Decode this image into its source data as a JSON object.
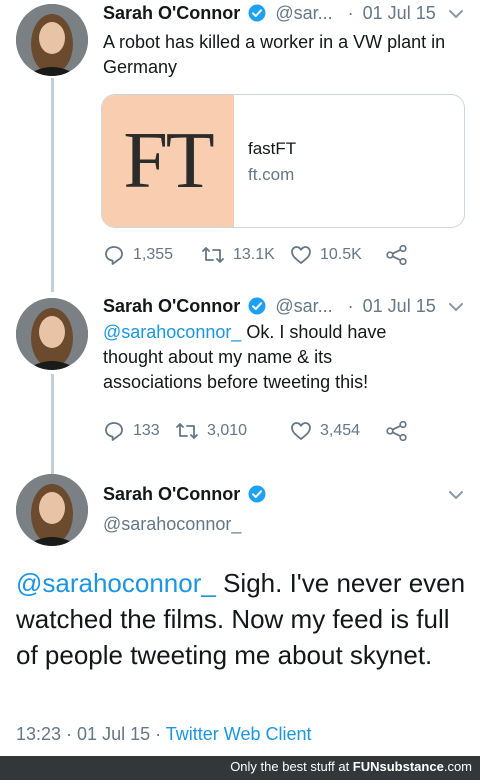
{
  "tweets": [
    {
      "name": "Sarah O'Connor",
      "handle": "@sar...",
      "dot": "·",
      "date": "01 Jul 15",
      "text": "A robot has killed a worker in a VW plant in Germany",
      "card": {
        "logo": "FT",
        "title": "fastFT",
        "domain": "ft.com"
      },
      "replies": "1,355",
      "retweets": "13.1K",
      "likes": "10.5K"
    },
    {
      "name": "Sarah O'Connor",
      "handle": "@sar...",
      "dot": "·",
      "date": "01 Jul 15",
      "mention": "@sarahoconnor_",
      "text": " Ok. I should have thought about my name & its associations before tweeting this!",
      "replies": "133",
      "retweets": "3,010",
      "likes": "3,454"
    }
  ],
  "main_tweet": {
    "name": "Sarah O'Connor",
    "handle": "@sarahoconnor_",
    "mention": "@sarahoconnor_",
    "text": " Sigh. I've never even watched the films. Now my feed is full of people tweeting me about skynet.",
    "time": "13:23",
    "sep1": " · ",
    "date": "01 Jul 15",
    "sep2": " · ",
    "client": "Twitter Web Client"
  },
  "watermark": {
    "prefix": "Only the best stuff at ",
    "brand": "FUNsubstance",
    "suffix": ".com"
  },
  "colors": {
    "link": "#1b95e0",
    "secondary": "#657786",
    "verified": "#1da1f2",
    "card_logo_bg": "#f9cdb0"
  },
  "icons": [
    "reply-icon",
    "retweet-icon",
    "like-icon",
    "share-icon",
    "verified-badge-icon",
    "chevron-down-icon"
  ]
}
